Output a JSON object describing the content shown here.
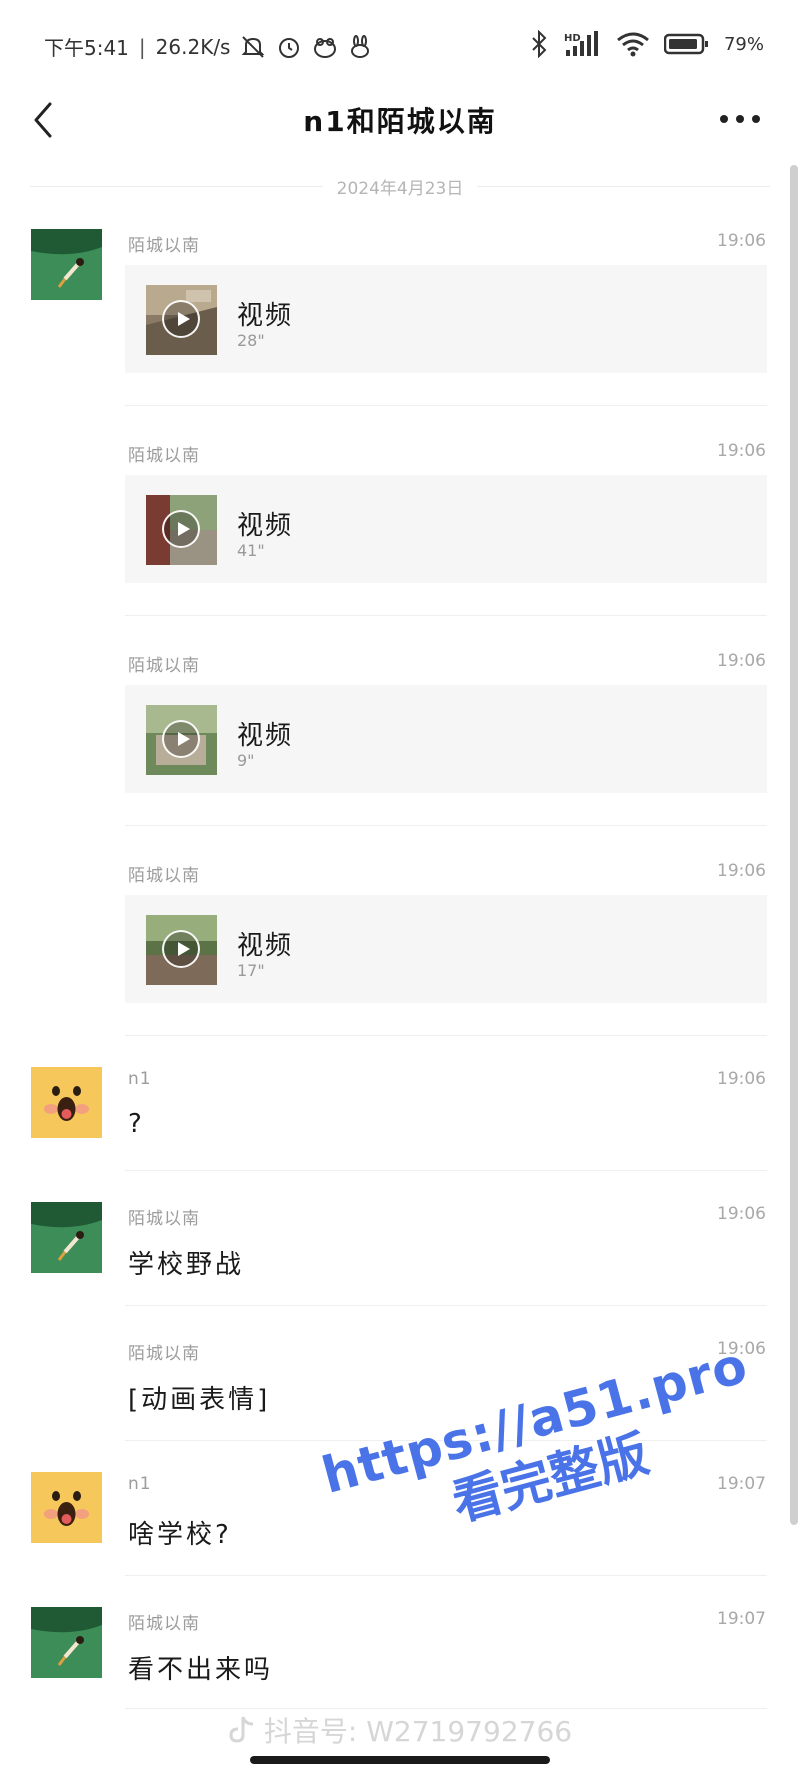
{
  "status_bar": {
    "time_text": "下午5:41",
    "network_speed": "26.2K/s",
    "battery_level": "79%",
    "signal_label": "HD"
  },
  "header": {
    "title": "n1和陌城以南"
  },
  "date_divider": "2024年4月23日",
  "messages": [
    {
      "sender": "陌城以南",
      "time": "19:06",
      "type": "video",
      "label": "视频",
      "duration": "28\""
    },
    {
      "sender": "陌城以南",
      "time": "19:06",
      "type": "video",
      "label": "视频",
      "duration": "41\""
    },
    {
      "sender": "陌城以南",
      "time": "19:06",
      "type": "video",
      "label": "视频",
      "duration": "9\""
    },
    {
      "sender": "陌城以南",
      "time": "19:06",
      "type": "video",
      "label": "视频",
      "duration": "17\""
    },
    {
      "sender": "n1",
      "time": "19:06",
      "type": "text",
      "text": "?"
    },
    {
      "sender": "陌城以南",
      "time": "19:06",
      "type": "text",
      "text": "学校野战"
    },
    {
      "sender": "陌城以南",
      "time": "19:06",
      "type": "text",
      "text": "[动画表情]"
    },
    {
      "sender": "n1",
      "time": "19:07",
      "type": "text",
      "text": "啥学校?"
    },
    {
      "sender": "陌城以南",
      "time": "19:07",
      "type": "text",
      "text": "看不出来吗"
    }
  ],
  "watermark": {
    "url": "https://a51.pro",
    "subtitle": "看完整版"
  },
  "douyin": {
    "text": "抖音号: W2719792766"
  },
  "colors": {
    "watermark_blue": "#4a73e8",
    "avatar_green": "#2f7d4a",
    "avatar_yellow": "#f6c75a"
  },
  "icons": {
    "back": "chevron-left-icon",
    "more": "ellipsis-icon",
    "play": "play-icon"
  }
}
